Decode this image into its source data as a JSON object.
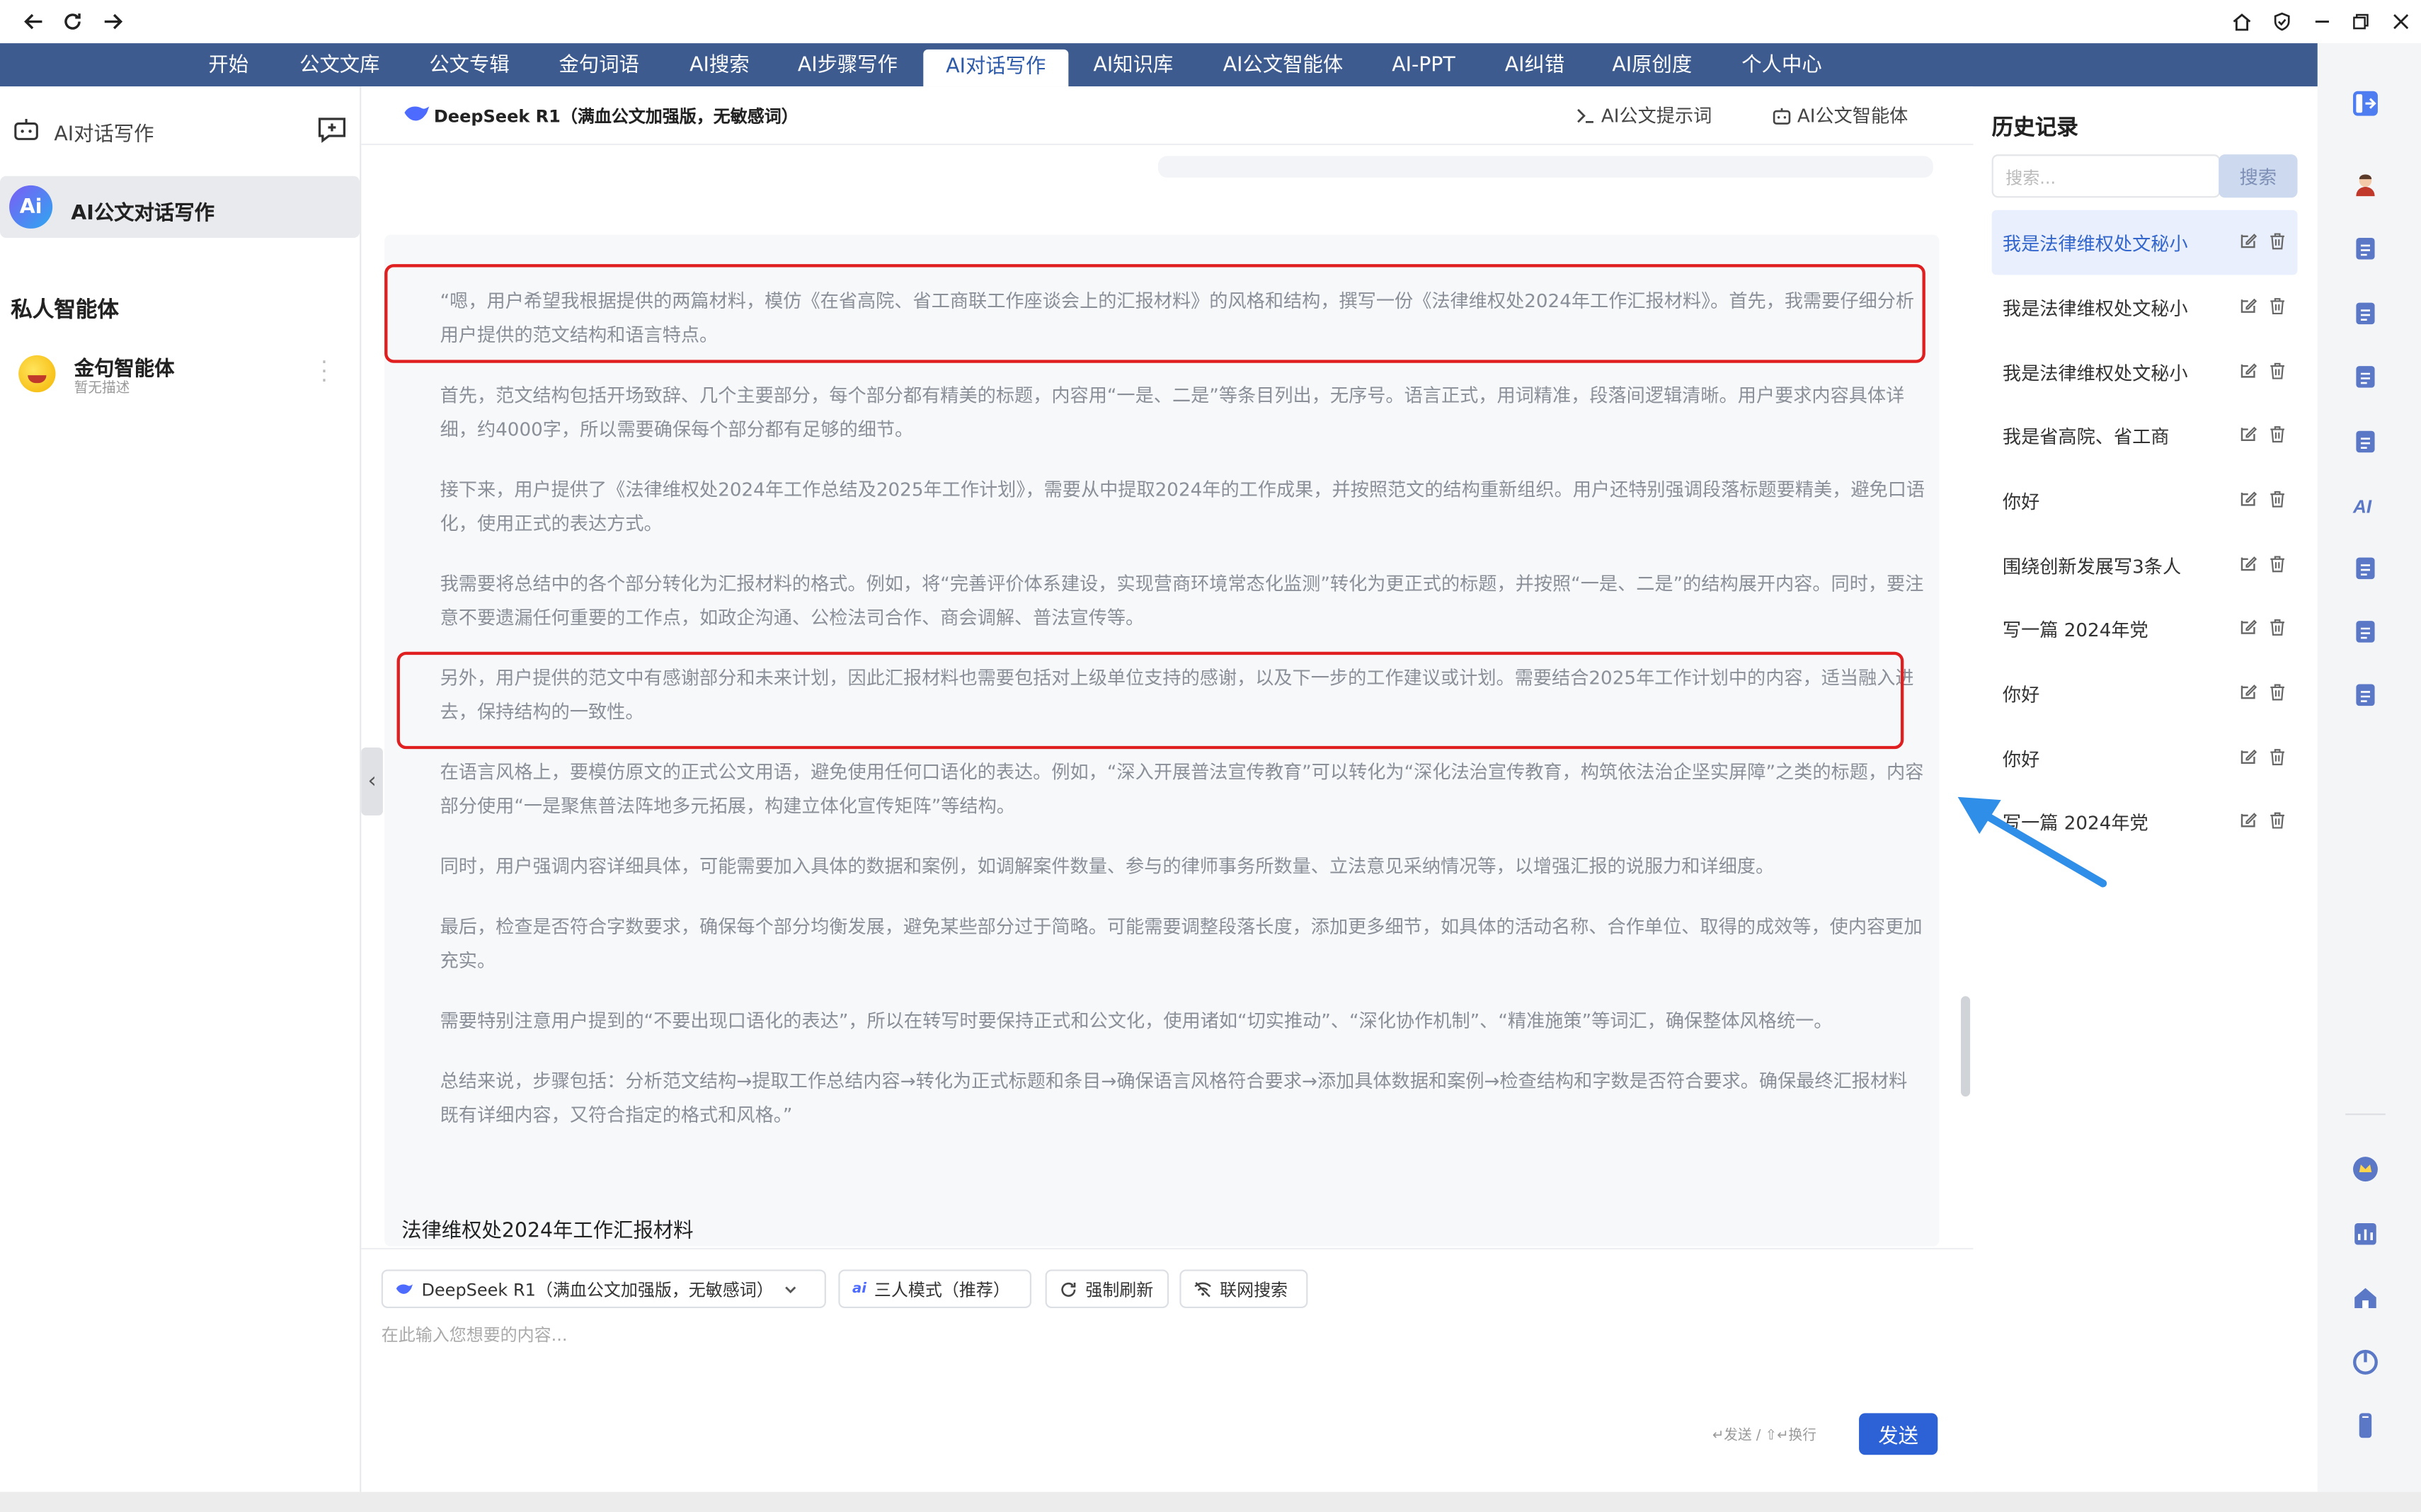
{
  "colors": {
    "nav_bg": "#3d5b8f",
    "accent": "#2d62d6",
    "highlight_border": "#e02020",
    "annotation_arrow": "#2f8ee8"
  },
  "browser": {
    "icons": [
      "back-icon",
      "refresh-icon",
      "forward-icon",
      "home-icon",
      "shield-icon",
      "minimize-icon",
      "restore-icon",
      "close-icon"
    ]
  },
  "nav": {
    "items": [
      "开始",
      "公文文库",
      "公文专辑",
      "金句词语",
      "AI搜索",
      "AI步骤写作",
      "AI对话写作",
      "AI知识库",
      "AI公文智能体",
      "AI-PPT",
      "AI纠错",
      "AI原创度",
      "个人中心"
    ],
    "active": "AI对话写作"
  },
  "left": {
    "title": "AI对话写作",
    "active_agent": {
      "logo": "Ai",
      "name": "AI公文对话写作"
    },
    "private_title": "私人智能体",
    "private_agents": [
      {
        "name": "金句智能体",
        "desc": "暂无描述"
      }
    ]
  },
  "main": {
    "model_title": "DeepSeek R1（满血公文加强版，无敏感词）",
    "header_buttons": [
      "AI公文提示词",
      "AI公文智能体"
    ],
    "paragraphs": [
      "“嗯，用户希望我根据提供的两篇材料，模仿《在省高院、省工商联工作座谈会上的汇报材料》的风格和结构，撰写一份《法律维权处2024年工作汇报材料》。首先，我需要仔细分析用户提供的范文结构和语言特点。",
      "首先，范文结构包括开场致辞、几个主要部分，每个部分都有精美的标题，内容用“一是、二是”等条目列出，无序号。语言正式，用词精准，段落间逻辑清晰。用户要求内容具体详细，约4000字，所以需要确保每个部分都有足够的细节。",
      "接下来，用户提供了《法律维权处2024年工作总结及2025年工作计划》，需要从中提取2024年的工作成果，并按照范文的结构重新组织。用户还特别强调段落标题要精美，避免口语化，使用正式的表达方式。",
      "我需要将总结中的各个部分转化为汇报材料的格式。例如，将“完善评价体系建设，实现营商环境常态化监测”转化为更正式的标题，并按照“一是、二是”的结构展开内容。同时，要注意不要遗漏任何重要的工作点，如政企沟通、公检法司合作、商会调解、普法宣传等。",
      "另外，用户提供的范文中有感谢部分和未来计划，因此汇报材料也需要包括对上级单位支持的感谢，以及下一步的工作建议或计划。需要结合2025年工作计划中的内容，适当融入进去，保持结构的一致性。",
      "在语言风格上，要模仿原文的正式公文用语，避免使用任何口语化的表达。例如，“深入开展普法宣传教育”可以转化为“深化法治宣传教育，构筑依法治企坚实屏障”之类的标题，内容部分使用“一是聚焦普法阵地多元拓展，构建立体化宣传矩阵”等结构。",
      "同时，用户强调内容详细具体，可能需要加入具体的数据和案例，如调解案件数量、参与的律师事务所数量、立法意见采纳情况等，以增强汇报的说服力和详细度。",
      "最后，检查是否符合字数要求，确保每个部分均衡发展，避免某些部分过于简略。可能需要调整段落长度，添加更多细节，如具体的活动名称、合作单位、取得的成效等，使内容更加充实。",
      "需要特别注意用户提到的“不要出现口语化的表达”，所以在转写时要保持正式和公文化，使用诸如“切实推动”、“深化协作机制”、“精准施策”等词汇，确保整体风格统一。",
      "总结来说，步骤包括：分析范文结构→提取工作总结内容→转化为正式标题和条目→确保语言风格符合要求→添加具体数据和案例→检查结构和字数是否符合要求。确保最终汇报材料既有详细内容，又符合指定的格式和风格。”"
    ],
    "doc_title": "法律维权处2024年工作汇报材料",
    "collapse_glyph": "‹",
    "input": {
      "model_chip": "DeepSeek R1（满血公文加强版，无敏感词）",
      "mode_chip": "三人模式（推荐）",
      "refresh_chip": "强制刷新",
      "web_chip": "联网搜索",
      "placeholder": "在此输入您想要的内容...",
      "send_hint": "↵发送 / ⇧↵换行",
      "send_label": "发送"
    }
  },
  "history": {
    "title": "历史记录",
    "search_placeholder": "搜索...",
    "search_button": "搜索",
    "items": [
      "我是法律维权处文秘小",
      "我是法律维权处文秘小",
      "我是法律维权处文秘小",
      "我是省高院、省工商",
      "你好",
      "围绕创新发展写3条人",
      "写一篇 2024年党",
      "你好",
      "你好",
      "写一篇 2024年党"
    ],
    "active_index": 0
  },
  "rail": {
    "icons": [
      "sidebar-toggle-icon",
      "avatar-icon",
      "toolbox-icon",
      "document-icon",
      "library-icon",
      "write-icon",
      "ai-icon",
      "report-icon",
      "ppt-icon",
      "original-icon",
      "vip-crown-icon",
      "chart-icon",
      "home-icon",
      "power-icon",
      "mobile-icon"
    ]
  }
}
